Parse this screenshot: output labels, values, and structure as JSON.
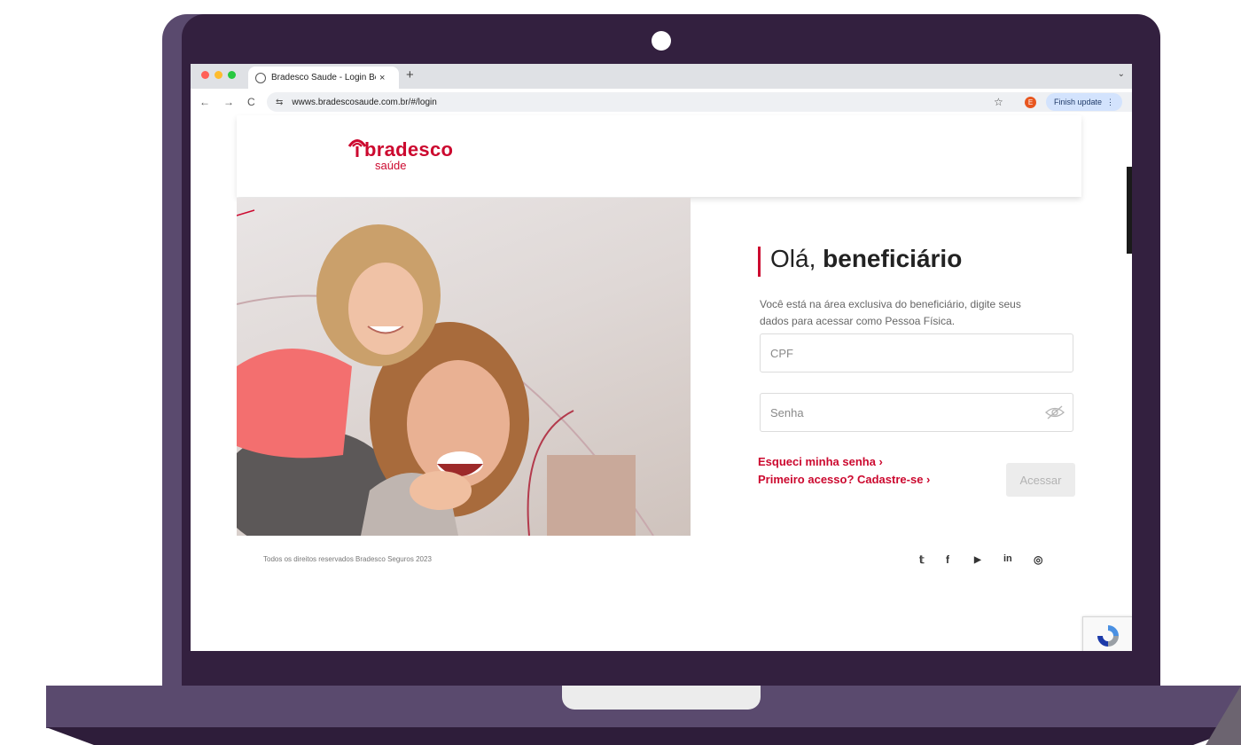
{
  "browser": {
    "tab_title": "Bradesco Saude - Login Ben",
    "tab_close": "×",
    "new_tab": "+",
    "tab_menu": "⌄",
    "back": "←",
    "forward": "→",
    "reload": "C",
    "site_settings": "⇆",
    "url": "wwws.bradescosaude.com.br/#/login",
    "bookmark": "☆",
    "profile_initial": "E",
    "update_label": "Finish update",
    "more_menu": "⋮",
    "window_controls": [
      "#ff5f57",
      "#febc2e",
      "#28c840"
    ]
  },
  "header": {
    "logo_name": "bradesco",
    "logo_sub": "saúde"
  },
  "login": {
    "greeting_prefix": "Olá, ",
    "greeting_bold": "beneficiário",
    "description": "Você está na área exclusiva do beneficiário, digite seus dados para acessar como Pessoa Física.",
    "cpf_placeholder": "CPF",
    "password_placeholder": "Senha",
    "forgot_link": "Esqueci minha senha ›",
    "signup_link": "Primeiro acesso? Cadastre-se ›",
    "submit_label": "Acessar"
  },
  "footer": {
    "copyright": "Todos os direitos reservados Bradesco Seguros 2023",
    "social": [
      {
        "icon": "twitter-icon",
        "glyph": "𝕥"
      },
      {
        "icon": "facebook-icon",
        "glyph": "f"
      },
      {
        "icon": "youtube-icon",
        "glyph": "▶"
      },
      {
        "icon": "linkedin-icon",
        "glyph": "in"
      },
      {
        "icon": "instagram-icon",
        "glyph": "◎"
      }
    ]
  },
  "colors": {
    "brand": "#cc092f",
    "laptop_frame": "#33203f"
  }
}
